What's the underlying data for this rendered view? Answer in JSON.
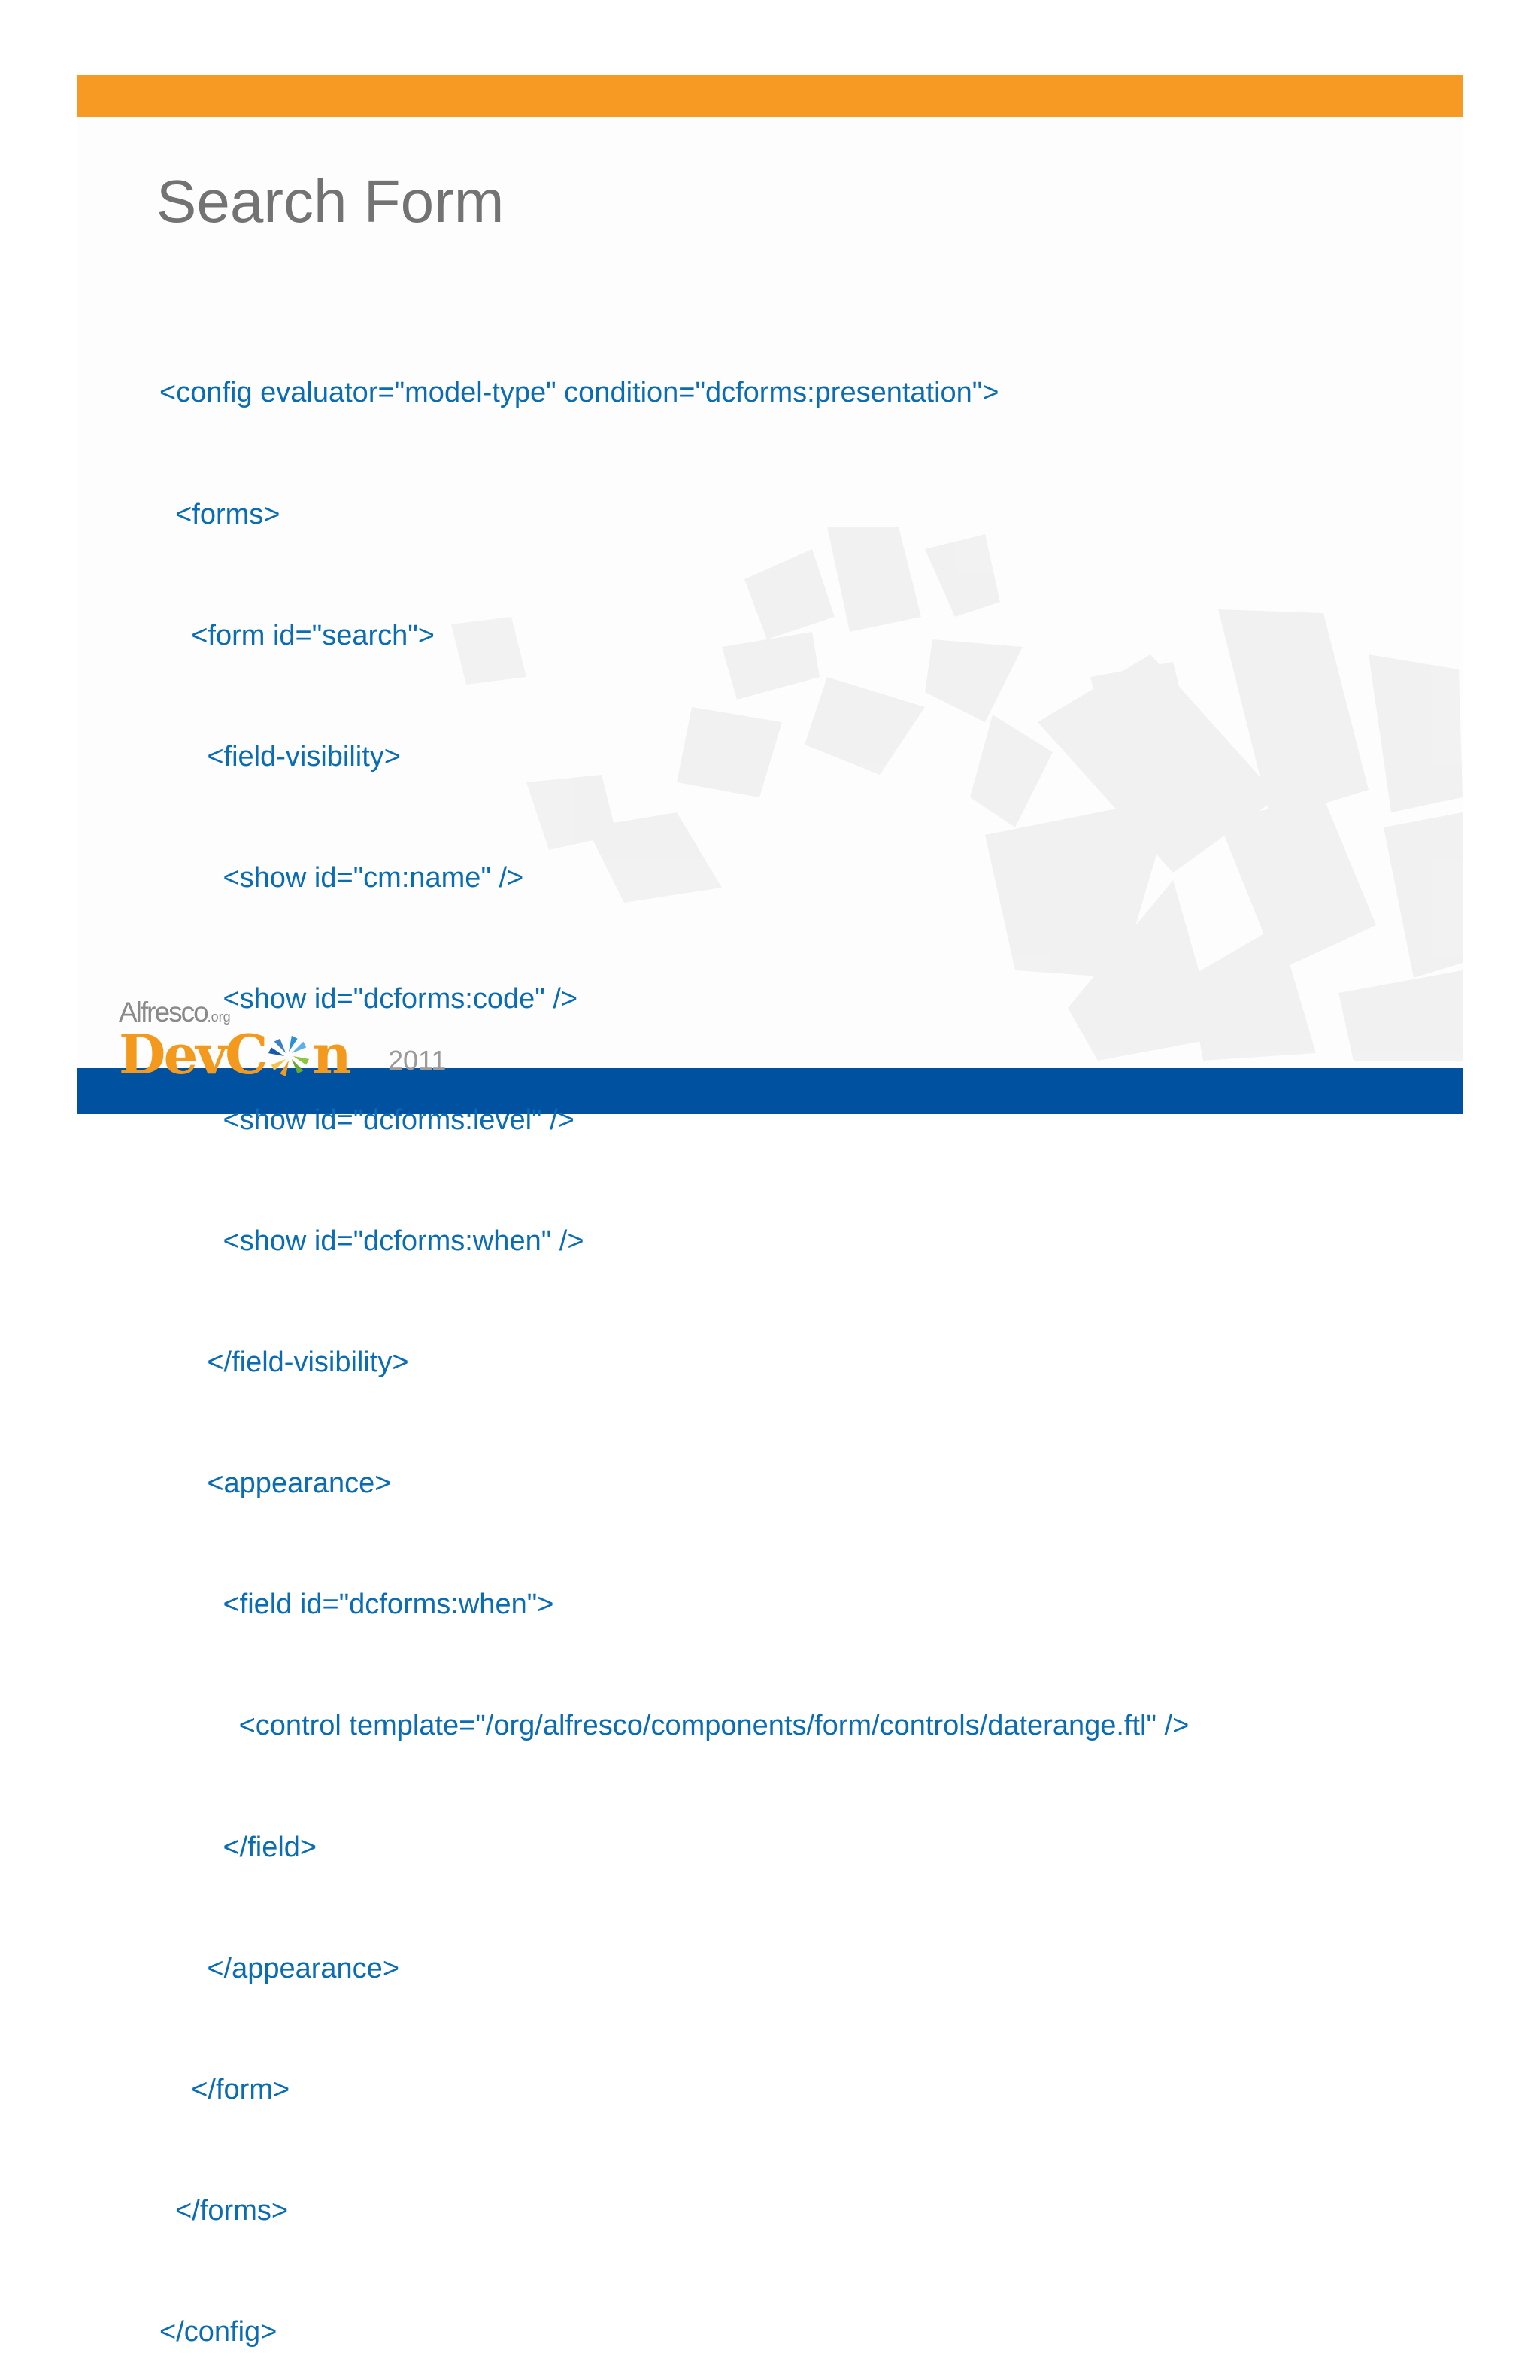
{
  "slide": {
    "title": "Search Form",
    "code_lines": [
      "<config evaluator=\"model-type\" condition=\"dcforms:presentation\">",
      "  <forms>",
      "    <form id=\"search\">",
      "      <field-visibility>",
      "        <show id=\"cm:name\" />",
      "        <show id=\"dcforms:code\" />",
      "        <show id=\"dcforms:level\" />",
      "        <show id=\"dcforms:when\" />",
      "      </field-visibility>",
      "      <appearance>",
      "        <field id=\"dcforms:when\">",
      "          <control template=\"/org/alfresco/components/form/controls/daterange.ftl\" />",
      "        </field>",
      "      </appearance>",
      "    </form>",
      "  </forms>",
      "</config>"
    ]
  },
  "logo": {
    "brand": "Alfresco",
    "brand_suffix": ".org",
    "word_left": "Dev",
    "word_right": "n",
    "mark_icon": "pinwheel-icon",
    "year": "2011"
  },
  "colors": {
    "top_bar": "#f79a24",
    "bottom_bar": "#0052a0",
    "title": "#737373",
    "code": "#0a6cb3",
    "logo_orange": "#f39a1e"
  }
}
